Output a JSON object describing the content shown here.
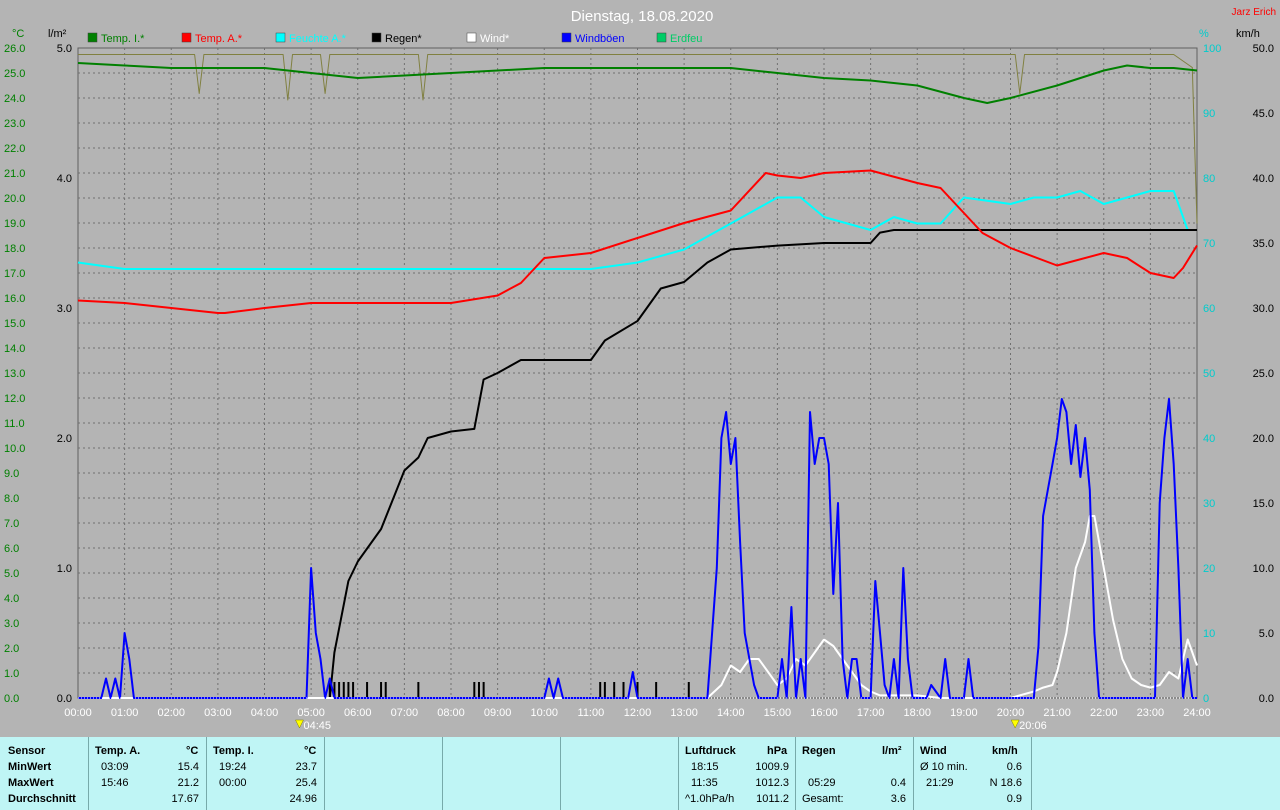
{
  "title": "Dienstag, 18.08.2020",
  "author": "Jarz Erich",
  "units": {
    "left_temp": "°C",
    "left_rain": "l/m²",
    "right_pct": "%",
    "right_wind": "km/h"
  },
  "legend": [
    {
      "label": "Temp. I.*",
      "color": "#008000"
    },
    {
      "label": "Temp. A.*",
      "color": "#ff0000"
    },
    {
      "label": "Feuchte A.*",
      "color": "#00ffff"
    },
    {
      "label": "Regen*",
      "color": "#000000"
    },
    {
      "label": "Wind*",
      "color": "#ffffff"
    },
    {
      "label": "Windböen",
      "color": "#0000ff"
    },
    {
      "label": "Erdfeu",
      "color": "#00cc66"
    }
  ],
  "sun_markers": [
    {
      "label": "04:45",
      "hour": 4.75
    },
    {
      "label": "20:06",
      "hour": 20.1
    }
  ],
  "chart_data": {
    "type": "line",
    "x_unit": "hour",
    "x_ticks": [
      "00:00",
      "01:00",
      "02:00",
      "03:00",
      "04:00",
      "05:00",
      "06:00",
      "07:00",
      "08:00",
      "09:00",
      "10:00",
      "11:00",
      "12:00",
      "13:00",
      "14:00",
      "15:00",
      "16:00",
      "17:00",
      "18:00",
      "19:00",
      "20:00",
      "21:00",
      "22:00",
      "23:00",
      "24:00"
    ],
    "xlim": [
      0,
      24
    ],
    "axes": {
      "temp": {
        "lim": [
          0,
          26
        ],
        "ticks": [
          "0.0",
          "1.0",
          "2.0",
          "3.0",
          "4.0",
          "5.0",
          "6.0",
          "7.0",
          "8.0",
          "9.0",
          "10.0",
          "11.0",
          "12.0",
          "13.0",
          "14.0",
          "15.0",
          "16.0",
          "17.0",
          "18.0",
          "19.0",
          "20.0",
          "21.0",
          "22.0",
          "23.0",
          "24.0",
          "25.0",
          "26.0"
        ],
        "color": "#00a000"
      },
      "rain": {
        "lim": [
          0,
          5
        ],
        "ticks": [
          "0.0",
          "1.0",
          "2.0",
          "3.0",
          "4.0",
          "5.0"
        ],
        "color": "#000000"
      },
      "humidity": {
        "lim": [
          0,
          100
        ],
        "ticks": [
          "0",
          "10",
          "20",
          "30",
          "40",
          "50",
          "60",
          "70",
          "80",
          "90",
          "100"
        ],
        "color": "#00cccc"
      },
      "wind": {
        "lim": [
          0,
          50
        ],
        "ticks": [
          "0.0",
          "5.0",
          "10.0",
          "15.0",
          "20.0",
          "25.0",
          "30.0",
          "35.0",
          "40.0",
          "45.0",
          "50.0"
        ],
        "color": "#000000"
      }
    },
    "series": [
      {
        "name": "Temp. I.*",
        "axis": "temp",
        "color": "#008000",
        "x": [
          0,
          1,
          2,
          3,
          4,
          5,
          5.5,
          6,
          7,
          8,
          9,
          10,
          11,
          12,
          13,
          14,
          15,
          15.5,
          16,
          17,
          18,
          19,
          19.5,
          20,
          21,
          22,
          22.5,
          23,
          23.5,
          24
        ],
        "y": [
          25.4,
          25.3,
          25.2,
          25.2,
          25.2,
          25.0,
          24.9,
          24.8,
          24.9,
          25.0,
          25.1,
          25.2,
          25.2,
          25.2,
          25.2,
          25.2,
          25.0,
          24.9,
          24.8,
          24.7,
          24.5,
          24.0,
          23.8,
          24.0,
          24.5,
          25.1,
          25.3,
          25.2,
          25.2,
          25.1
        ]
      },
      {
        "name": "Temp. A.*",
        "axis": "temp",
        "color": "#ff0000",
        "x": [
          0,
          1,
          2,
          3,
          3.15,
          4,
          5,
          6,
          7,
          8,
          9,
          9.5,
          10,
          11,
          12,
          13,
          14,
          14.75,
          15,
          15.5,
          16,
          17,
          18,
          18.5,
          19,
          19.4,
          20,
          21,
          22,
          22.5,
          23,
          23.5,
          23.7,
          24
        ],
        "y": [
          15.9,
          15.8,
          15.6,
          15.4,
          15.4,
          15.6,
          15.8,
          15.8,
          15.8,
          15.8,
          16.1,
          16.6,
          17.6,
          17.8,
          18.4,
          19.0,
          19.5,
          21.0,
          20.9,
          20.8,
          21.0,
          21.1,
          20.6,
          20.4,
          19.4,
          18.6,
          18.0,
          17.3,
          17.8,
          17.6,
          17.0,
          16.8,
          17.2,
          18.1
        ]
      },
      {
        "name": "Feuchte A.*",
        "axis": "humidity",
        "color": "#00ffff",
        "x": [
          0,
          1,
          2,
          3,
          4,
          5,
          6,
          7,
          8,
          9,
          10,
          11,
          12,
          13,
          13.5,
          14,
          14.5,
          15,
          15.5,
          16,
          17,
          17.5,
          18,
          18.5,
          19,
          20,
          20.5,
          21,
          21.5,
          22,
          22.5,
          23,
          23.5,
          23.8,
          24
        ],
        "y": [
          67,
          66,
          66,
          66,
          66,
          66,
          66,
          66,
          66,
          66,
          66,
          66,
          67,
          69,
          71,
          73,
          75,
          77,
          77,
          74,
          72,
          74,
          73,
          73,
          77,
          76,
          77,
          77,
          78,
          76,
          77,
          78,
          78,
          72,
          72
        ]
      },
      {
        "name": "Regen*",
        "axis": "rain",
        "color": "#000000",
        "x": [
          0,
          5.4,
          5.5,
          5.8,
          6,
          6.5,
          7,
          7.3,
          7.5,
          8,
          8.5,
          8.7,
          9,
          9.5,
          10,
          11,
          11.3,
          12,
          12.5,
          13,
          13.5,
          14,
          15,
          16,
          17,
          17.2,
          17.5,
          18,
          19,
          20,
          21,
          22,
          23,
          24
        ],
        "y": [
          0,
          0,
          0.35,
          0.9,
          1.05,
          1.3,
          1.75,
          1.85,
          2.0,
          2.05,
          2.07,
          2.45,
          2.5,
          2.6,
          2.6,
          2.6,
          2.75,
          2.9,
          3.15,
          3.2,
          3.35,
          3.45,
          3.48,
          3.5,
          3.5,
          3.58,
          3.6,
          3.6,
          3.6,
          3.6,
          3.6,
          3.6,
          3.6,
          3.6
        ]
      },
      {
        "name": "Windböen",
        "axis": "wind",
        "color": "#0000ff",
        "x": [
          0,
          0.5,
          0.6,
          0.7,
          0.8,
          0.9,
          1.0,
          1.1,
          1.2,
          4.9,
          5.0,
          5.1,
          5.2,
          5.3,
          5.4,
          5.5,
          10.0,
          10.1,
          10.2,
          10.3,
          10.4,
          11.8,
          11.9,
          12.0,
          12.1,
          13.5,
          13.6,
          13.7,
          13.8,
          13.9,
          14.0,
          14.1,
          14.2,
          14.3,
          14.4,
          14.5,
          14.6,
          15.0,
          15.1,
          15.2,
          15.3,
          15.4,
          15.5,
          15.6,
          15.7,
          15.8,
          15.9,
          16.0,
          16.1,
          16.2,
          16.3,
          16.4,
          16.5,
          16.6,
          16.7,
          16.8,
          17.0,
          17.1,
          17.2,
          17.3,
          17.4,
          17.5,
          17.6,
          17.7,
          17.8,
          17.9,
          18.0,
          18.1,
          18.2,
          18.3,
          18.5,
          18.6,
          18.7,
          19.0,
          19.1,
          19.2,
          20.5,
          20.6,
          20.7,
          20.8,
          20.9,
          21.0,
          21.1,
          21.2,
          21.3,
          21.4,
          21.5,
          21.6,
          21.7,
          21.8,
          21.9,
          22.0,
          22.1,
          22.2,
          23.0,
          23.1,
          23.2,
          23.3,
          23.4,
          23.5,
          23.6,
          23.7,
          23.8,
          23.9,
          24.0
        ],
        "y": [
          0,
          0,
          1.5,
          0,
          1.5,
          0,
          5,
          3,
          0,
          0,
          10,
          5,
          3,
          0,
          1.5,
          0,
          0,
          1.5,
          0,
          1.5,
          0,
          0,
          2,
          0,
          0,
          0,
          5,
          10,
          20,
          22,
          18,
          20,
          12,
          5,
          3,
          1,
          0,
          0,
          3,
          0,
          7,
          0,
          3,
          0,
          22,
          18,
          20,
          20,
          18,
          8,
          15,
          3,
          0,
          3,
          3,
          0,
          0,
          9,
          5,
          1,
          0,
          3,
          0,
          10,
          3,
          0,
          0,
          0,
          0,
          1,
          0,
          3,
          0,
          0,
          3,
          0,
          0,
          4,
          14,
          16,
          18,
          20,
          23,
          22,
          18,
          21,
          17,
          20,
          16,
          5,
          0,
          0,
          0,
          0,
          0,
          0,
          15,
          20,
          23,
          18,
          10,
          0,
          3,
          0,
          0
        ]
      },
      {
        "name": "Wind*",
        "axis": "wind",
        "color": "#ffffff",
        "x": [
          0,
          13.5,
          13.8,
          14.0,
          14.2,
          14.4,
          14.6,
          14.8,
          15.0,
          15.2,
          15.4,
          15.6,
          15.8,
          16.0,
          16.2,
          16.4,
          16.6,
          16.8,
          17.0,
          17.2,
          17.5,
          18.0,
          18.5,
          19.0,
          20.0,
          20.5,
          20.7,
          20.9,
          21.0,
          21.2,
          21.4,
          21.6,
          21.7,
          21.8,
          22.0,
          22.2,
          22.4,
          22.6,
          22.8,
          23.0,
          23.2,
          23.4,
          23.6,
          23.8,
          24.0
        ],
        "y": [
          0,
          0,
          1,
          2.5,
          2,
          3,
          3,
          2,
          1,
          1.5,
          3,
          2.5,
          3.5,
          4.5,
          4,
          3,
          2,
          1,
          0.5,
          0.2,
          0.2,
          0.2,
          0,
          0,
          0,
          0.5,
          0.8,
          1,
          2,
          5,
          10,
          12,
          14,
          14,
          10,
          6,
          3,
          1.5,
          1,
          0.8,
          1,
          2,
          1.5,
          4.5,
          2.5
        ]
      },
      {
        "name": "Erdfeu",
        "axis": "humidity",
        "color": "#808040",
        "x": [
          0,
          0.5,
          1,
          1.5,
          2,
          2.5,
          2.6,
          2.7,
          3,
          3.5,
          4,
          4.4,
          4.5,
          4.6,
          5,
          5.2,
          5.3,
          5.4,
          6,
          7,
          7.3,
          7.4,
          7.5,
          8,
          9,
          10,
          11,
          12,
          13,
          14,
          15,
          16,
          17,
          18,
          19,
          20,
          20.1,
          20.2,
          20.3,
          21,
          22,
          23,
          23.5,
          23.9,
          24
        ],
        "y": [
          99,
          99,
          99,
          99,
          99,
          99,
          93,
          99,
          99,
          99,
          99,
          99,
          92,
          99,
          99,
          99,
          93,
          99,
          99,
          99,
          99,
          92,
          99,
          99,
          99,
          99,
          99,
          99,
          99,
          99,
          99,
          99,
          99,
          99,
          99,
          99,
          99,
          93,
          99,
          99,
          99,
          99,
          99,
          97,
          73
        ]
      }
    ],
    "rain_bars": [
      5.4,
      5.5,
      5.6,
      5.7,
      5.8,
      5.9,
      6.2,
      6.5,
      6.6,
      7.3,
      8.5,
      8.6,
      8.7,
      11.2,
      11.3,
      11.5,
      11.7,
      12.0,
      12.4,
      13.1
    ]
  },
  "summary": {
    "sensor": {
      "header": "Sensor",
      "rows": [
        "MinWert",
        "MaxWert",
        "Durchschnitt"
      ]
    },
    "temp_a": {
      "header": "Temp. A.",
      "unit": "°C",
      "min_time": "03:09",
      "min": "15.4",
      "max_time": "15:46",
      "max": "21.2",
      "avg": "17.67"
    },
    "temp_i": {
      "header": "Temp. I.",
      "unit": "°C",
      "min_time": "19:24",
      "min": "23.7",
      "max_time": "00:00",
      "max": "25.4",
      "avg": "24.96"
    },
    "pressure": {
      "header": "Luftdruck",
      "unit": "hPa",
      "min_time": "18:15",
      "min": "1009.9",
      "max_time": "11:35",
      "max": "1012.3",
      "trend_label": "^1.0hPa/h",
      "current": "1011.2"
    },
    "rain": {
      "header": "Regen",
      "unit": "l/m²",
      "max_time": "05:29",
      "max": "0.4",
      "total_label": "Gesamt:",
      "total": "3.6"
    },
    "wind": {
      "header": "Wind",
      "unit": "km/h",
      "avg_label": "Ø 10 min.",
      "avg": "0.6",
      "max_time": "21:29",
      "max": "N 18.6",
      "last": "0.9"
    }
  }
}
